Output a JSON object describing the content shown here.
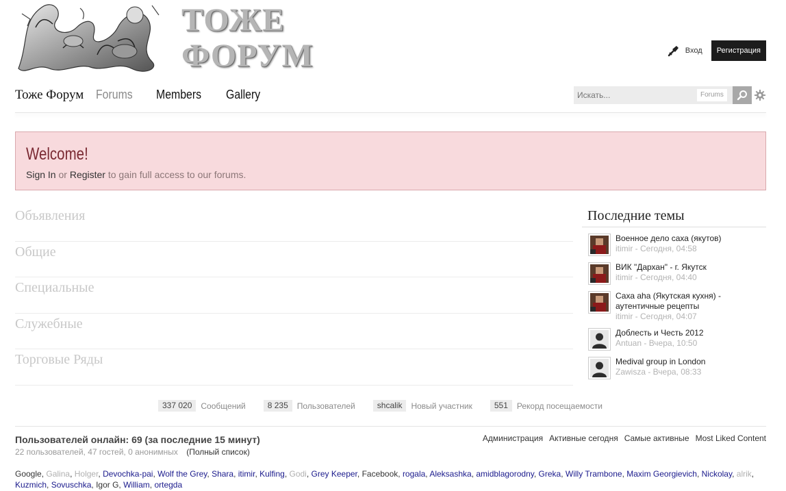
{
  "header": {
    "logo_line1": "ТОЖЕ",
    "logo_line2": "ФОРУМ",
    "signin_label": "Вход",
    "register_label": "Регистрация"
  },
  "nav": {
    "brand": "Тоже Форум",
    "forums": "Forums",
    "members": "Members",
    "gallery": "Gallery"
  },
  "search": {
    "placeholder": "Искать...",
    "scope": "Forums"
  },
  "welcome": {
    "title": "Welcome!",
    "sign_in": "Sign In",
    "or": "or",
    "register": "Register",
    "rest": "to gain full access to our forums."
  },
  "categories": [
    "Объявления",
    "Общие",
    "Специальные",
    "Служебные",
    "Торговые Ряды"
  ],
  "sidebar": {
    "title": "Последние темы",
    "topics": [
      {
        "title": "Военное дело саха (якутов)",
        "meta": "itimir - Сегодня, 04:58",
        "avatar": "photo"
      },
      {
        "title": "ВИК \"Дархан\" - г. Якутск",
        "meta": "itimir - Сегодня, 04:40",
        "avatar": "photo"
      },
      {
        "title": "Саха аhа (Якутская кухня) - аутентичные рецепты",
        "meta": "itimir - Сегодня, 04:07",
        "avatar": "photo"
      },
      {
        "title": "Доблесть и Честь 2012",
        "meta": "Antuan - Вчера, 10:50",
        "avatar": "default"
      },
      {
        "title": "Medival group in London",
        "meta": "Zawisza - Вчера, 08:33",
        "avatar": "default"
      }
    ]
  },
  "stats": [
    {
      "value": "337 020",
      "label": "Сообщений"
    },
    {
      "value": "8 235",
      "label": "Пользователей"
    },
    {
      "value": "shcalik",
      "label": "Новый участник"
    },
    {
      "value": "551",
      "label": "Рекорд посещаемости"
    }
  ],
  "online": {
    "title": "Пользователей онлайн: 69 (за последние 15 минут)",
    "subtitle": "22 пользователей, 47 гостей, 0 анонимных",
    "full_list": "(Полный список)",
    "tabs": [
      "Администрация",
      "Активные сегодня",
      "Самые активные",
      "Most Liked Content"
    ],
    "users": [
      {
        "name": "Google",
        "style": "plain"
      },
      {
        "name": "Galina",
        "style": "muted"
      },
      {
        "name": "Holger",
        "style": "muted"
      },
      {
        "name": "Devochka-pai",
        "style": "member"
      },
      {
        "name": "Wolf the Grey",
        "style": "member"
      },
      {
        "name": "Shara",
        "style": "member"
      },
      {
        "name": "itimir",
        "style": "member"
      },
      {
        "name": "Kulfing",
        "style": "member"
      },
      {
        "name": "Godi",
        "style": "muted"
      },
      {
        "name": "Grey Keeper",
        "style": "member"
      },
      {
        "name": "Facebook",
        "style": "plain"
      },
      {
        "name": "rogala",
        "style": "member"
      },
      {
        "name": "Aleksashka",
        "style": "member"
      },
      {
        "name": "amidblagorodny",
        "style": "member"
      },
      {
        "name": "Greka",
        "style": "member"
      },
      {
        "name": "Willy Trambone",
        "style": "member"
      },
      {
        "name": "Maxim Georgievich",
        "style": "member"
      },
      {
        "name": "Nickolay",
        "style": "member"
      },
      {
        "name": "alrik",
        "style": "muted"
      },
      {
        "name": "Kuzmich",
        "style": "member"
      },
      {
        "name": "Sovuschka",
        "style": "member"
      },
      {
        "name": "Igor G",
        "style": "plain"
      },
      {
        "name": "William",
        "style": "member"
      },
      {
        "name": "ortegda",
        "style": "member"
      }
    ]
  },
  "colors": {
    "welcome_bg": "#f8dadd",
    "welcome_title": "#7a2a33",
    "register_bg": "#1c1c1c",
    "member_link": "#1a1a8c"
  }
}
